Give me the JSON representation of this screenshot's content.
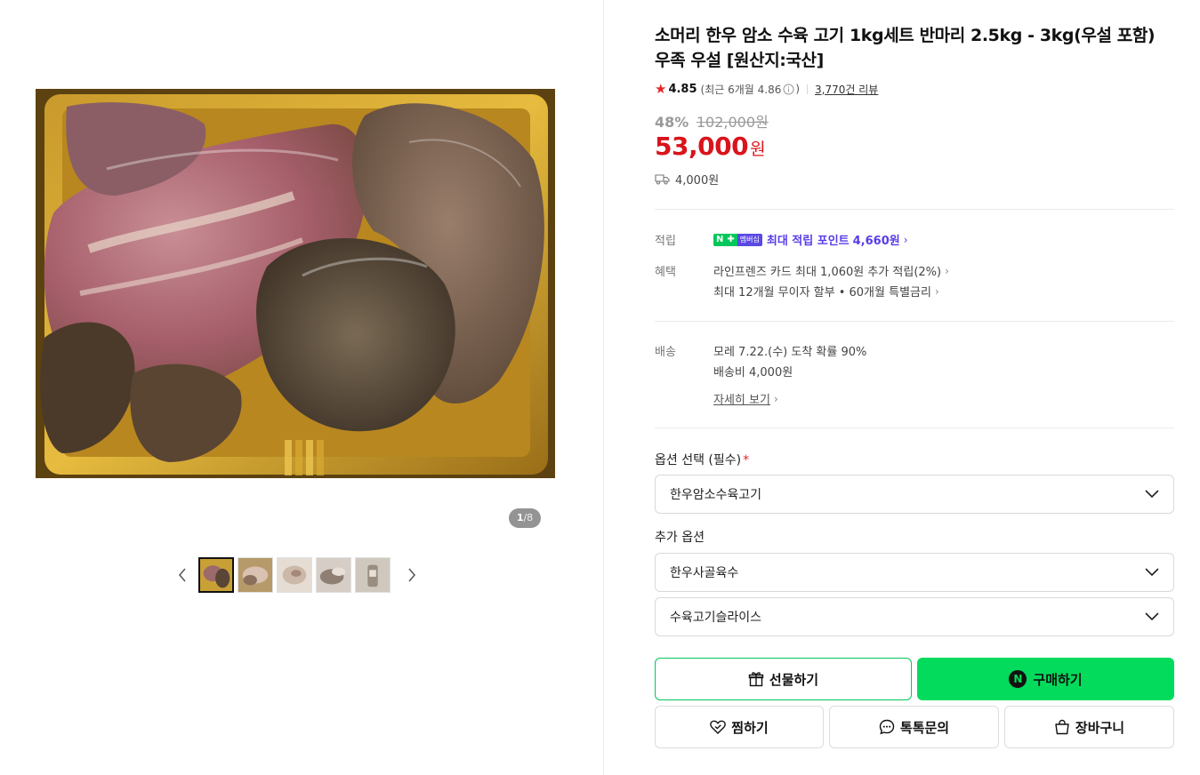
{
  "gallery": {
    "counter_current": "1",
    "counter_total": "/8",
    "thumbnail_count": 5,
    "active_thumbnail": 1
  },
  "product": {
    "title": "소머리 한우 암소 수육 고기 1kg세트 반마리 2.5kg - 3kg(우설 포함) 우족 우설 [원산지:국산]",
    "rating": "4.85",
    "recent_rating": "(최근 6개월 4.86",
    "recent_rating_close": ")",
    "reviews": "3,770건 리뷰",
    "discount": "48%",
    "original_price": "102,000원",
    "price": "53,000",
    "price_unit": "원",
    "shipping_fee": "4,000원"
  },
  "benefits": {
    "points_label": "적립",
    "npay_n": "N",
    "npay_plus": "✚",
    "npay_member": "멤버십",
    "points_text": "최대 적립 포인트",
    "points_value": "4,660원",
    "benefit_label": "혜택",
    "card_benefit": "라인프렌즈 카드 최대 1,060원 추가 적립(2%)",
    "installment": "최대 12개월 무이자 할부 • 60개월 특별금리"
  },
  "delivery": {
    "label": "배송",
    "arrival": "모레 7.22.(수) 도착 확률 90%",
    "fee": "배송비 4,000원",
    "detail_link": "자세히 보기"
  },
  "options": {
    "required_label": "옵션 선택 (필수)",
    "required_mark": "*",
    "required_selected": "한우암소수육고기",
    "extra_label": "추가 옵션",
    "extra_1": "한우사골육수",
    "extra_2": "수육고기슬라이스"
  },
  "actions": {
    "gift": "선물하기",
    "buy": "구매하기",
    "buy_badge": "N",
    "wish": "찜하기",
    "talk": "톡톡문의",
    "cart": "장바구니"
  },
  "colors": {
    "price_red": "#d9141c",
    "naver_green": "#03db5c",
    "point_purple": "#5a3ce8"
  }
}
